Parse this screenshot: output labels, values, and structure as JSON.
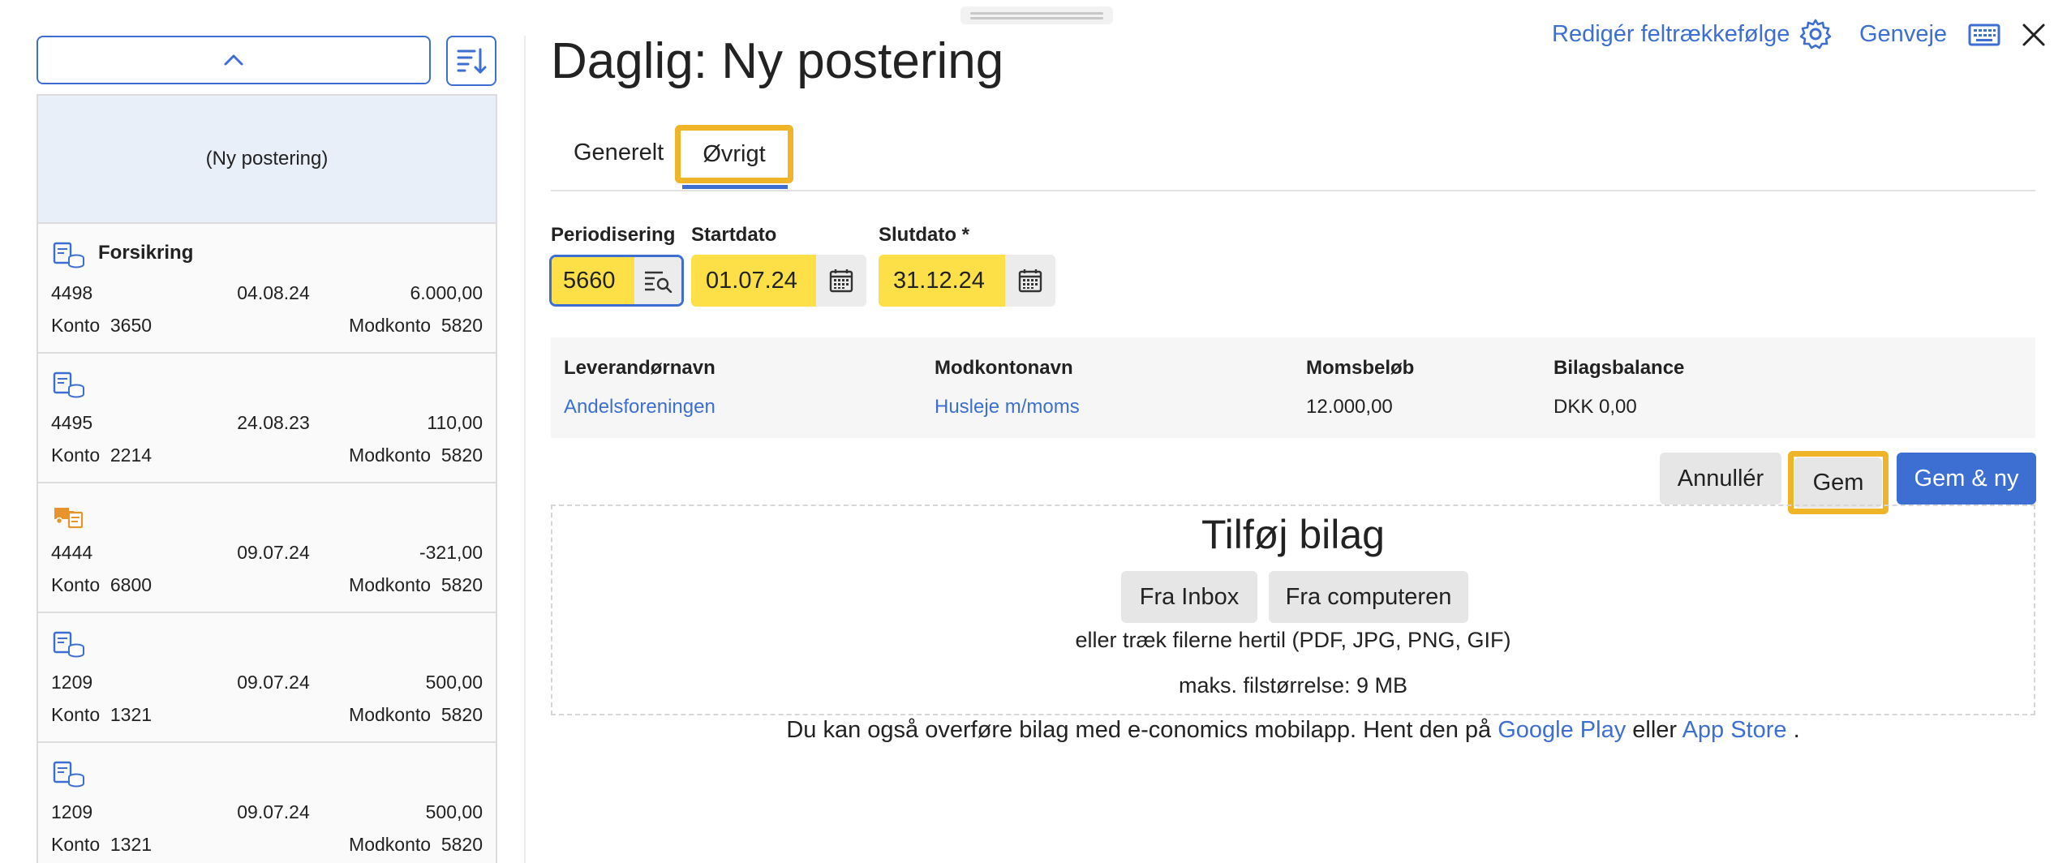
{
  "header": {
    "title": "Daglig: Ny postering",
    "edit_field_order": "Redigér feltrækkefølge",
    "shortcuts": "Genveje"
  },
  "icons": {
    "gear": "gear-icon",
    "keyboard": "keyboard-icon",
    "close": "close-icon",
    "sort": "sort-icon",
    "chevron": "chevron-up-icon",
    "lookup": "list-search-icon",
    "calendar": "calendar-icon"
  },
  "colors": {
    "accent": "#3c6fd1",
    "highlight": "#f0b429",
    "field_yellow": "#fde047"
  },
  "tabs": [
    {
      "label": "Generelt"
    },
    {
      "label": "Øvrigt",
      "active": true
    }
  ],
  "fields": {
    "periodisering": {
      "label": "Periodisering",
      "value": "5660"
    },
    "startdato": {
      "label": "Startdato",
      "value": "01.07.24"
    },
    "slutdato": {
      "label": "Slutdato *",
      "value": "31.12.24"
    }
  },
  "info": {
    "headers": [
      "Leverandørnavn",
      "Modkontonavn",
      "Momsbeløb",
      "Bilagsbalance"
    ],
    "values": [
      "Andelsforeningen",
      "Husleje m/moms",
      "12.000,00",
      "DKK 0,00"
    ]
  },
  "actions": {
    "cancel": "Annullér",
    "save": "Gem",
    "save_new": "Gem & ny"
  },
  "attachment": {
    "title": "Tilføj bilag",
    "from_inbox": "Fra Inbox",
    "from_computer": "Fra computeren",
    "drag_hint": "eller træk filerne hertil (PDF, JPG, PNG, GIF)",
    "max_size": "maks. filstørrelse: 9 MB"
  },
  "footer": {
    "text_before": "Du kan også overføre bilag med e-conomics mobilapp. Hent den på ",
    "google_play": "Google Play",
    "middle": " eller ",
    "app_store": "App Store",
    "after": " ."
  },
  "sidebar": {
    "new_entry": "(Ny postering)",
    "entries": [
      {
        "icon": "ledger-coins-icon",
        "title": "Forsikring",
        "number": "4498",
        "date": "04.08.24",
        "amount": "6.000,00",
        "konto_label": "Konto",
        "konto": "3650",
        "modkonto_label": "Modkonto",
        "modkonto": "5820"
      },
      {
        "icon": "ledger-coins-icon",
        "title": "",
        "number": "4495",
        "date": "24.08.23",
        "amount": "110,00",
        "konto_label": "Konto",
        "konto": "2214",
        "modkonto_label": "Modkonto",
        "modkonto": "5820"
      },
      {
        "icon": "truck-document-icon",
        "title": "",
        "number": "4444",
        "date": "09.07.24",
        "amount": "-321,00",
        "konto_label": "Konto",
        "konto": "6800",
        "modkonto_label": "Modkonto",
        "modkonto": "5820"
      },
      {
        "icon": "ledger-coins-icon",
        "title": "",
        "number": "1209",
        "date": "09.07.24",
        "amount": "500,00",
        "konto_label": "Konto",
        "konto": "1321",
        "modkonto_label": "Modkonto",
        "modkonto": "5820"
      },
      {
        "icon": "ledger-coins-icon",
        "title": "",
        "number": "1209",
        "date": "09.07.24",
        "amount": "500,00",
        "konto_label": "Konto",
        "konto": "1321",
        "modkonto_label": "Modkonto",
        "modkonto": "5820"
      }
    ]
  }
}
